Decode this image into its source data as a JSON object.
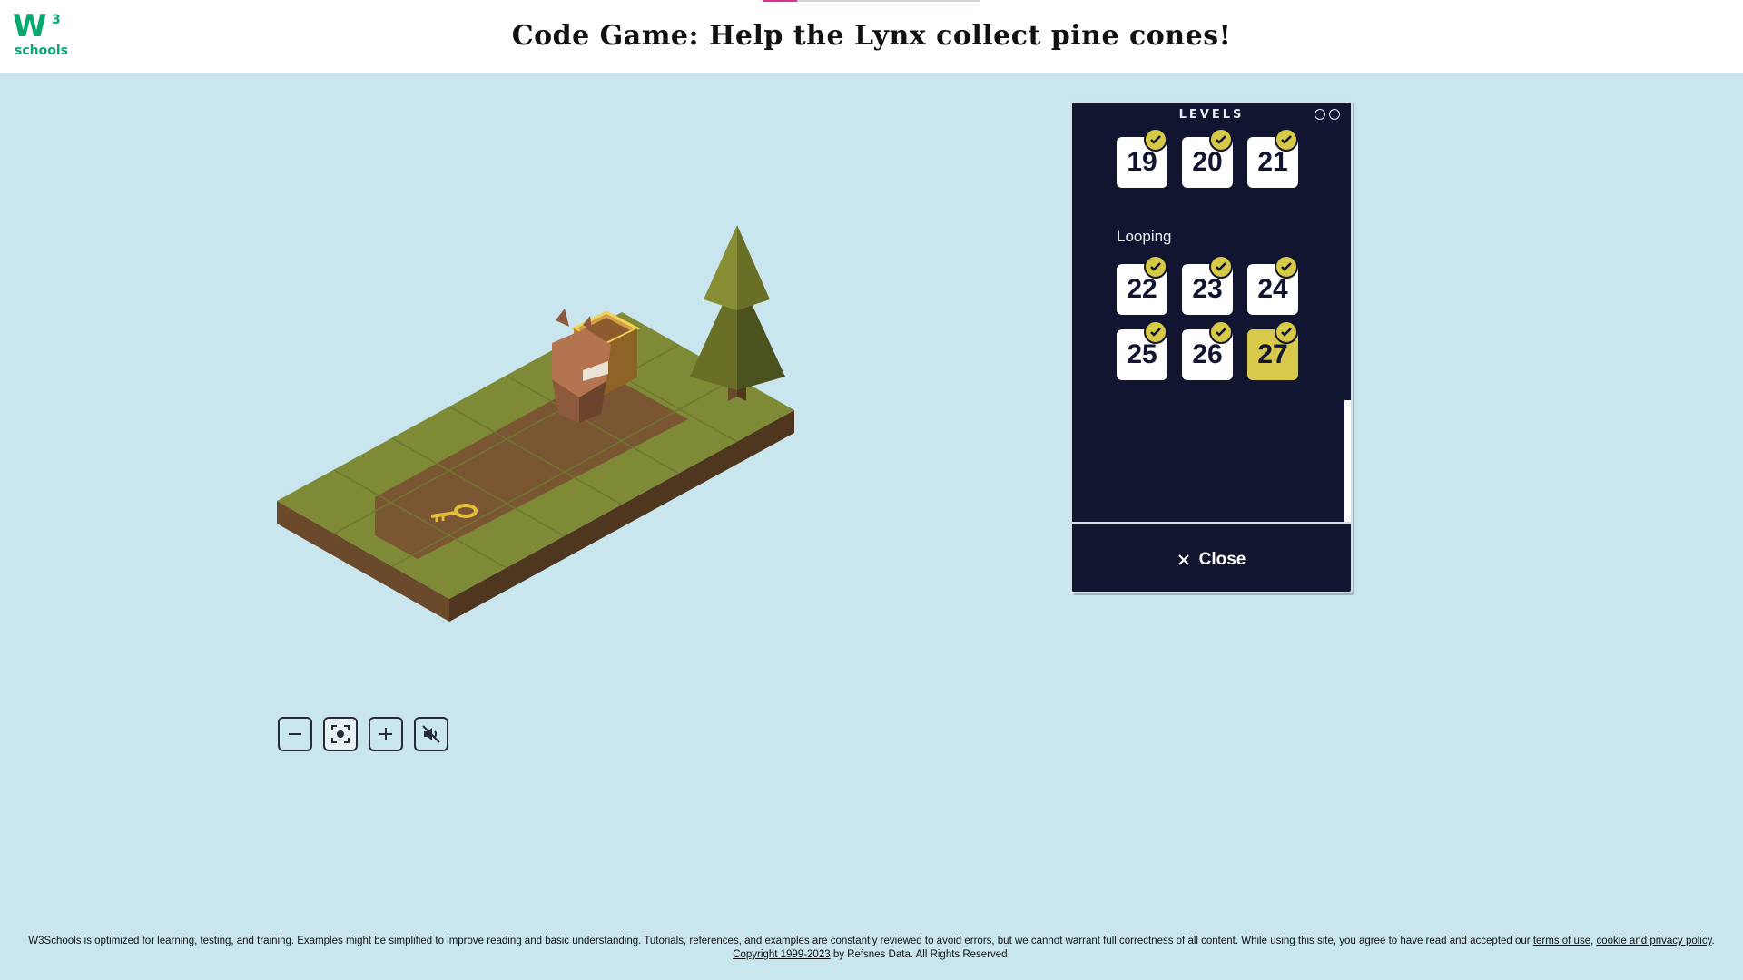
{
  "header": {
    "logo_main": "W",
    "logo_sup": "3",
    "logo_sub": "schools",
    "title": "Code Game: Help the Lynx collect pine cones!",
    "progress_fraction": 0.16
  },
  "controls": [
    {
      "name": "zoom-out-button",
      "icon": "minus-icon",
      "glyph": "−"
    },
    {
      "name": "recenter-button",
      "icon": "focus-icon",
      "glyph": "◉"
    },
    {
      "name": "zoom-in-button",
      "icon": "plus-icon",
      "glyph": "+"
    },
    {
      "name": "mute-button",
      "icon": "speaker-muted-icon",
      "glyph": "🔇"
    }
  ],
  "levels_panel": {
    "title": "LEVELS",
    "rows_top": [
      "19",
      "20",
      "21"
    ],
    "section_label": "Looping",
    "rows_loop1": [
      "22",
      "23",
      "24"
    ],
    "rows_loop2": [
      "25",
      "26",
      "27"
    ],
    "current_level": "27",
    "close_label": "Close"
  },
  "footer": {
    "text": "W3Schools is optimized for learning, testing, and training. Examples might be simplified to improve reading and basic understanding. Tutorials, references, and examples are constantly reviewed to avoid errors, but we cannot warrant full correctness of all content. While using this site, you agree to have read and accepted our ",
    "terms_link": "terms of use",
    "comma": ", ",
    "privacy_link": "cookie and privacy policy",
    "period": ".",
    "copyright_link": "Copyright 1999-2023",
    "copyright_tail": " by Refsnes Data. All Rights Reserved."
  },
  "colors": {
    "background": "#c9e5ee",
    "panel": "#121530",
    "check": "#d6c945",
    "grass": "#7f8a36",
    "dirt": "#7b5633"
  }
}
